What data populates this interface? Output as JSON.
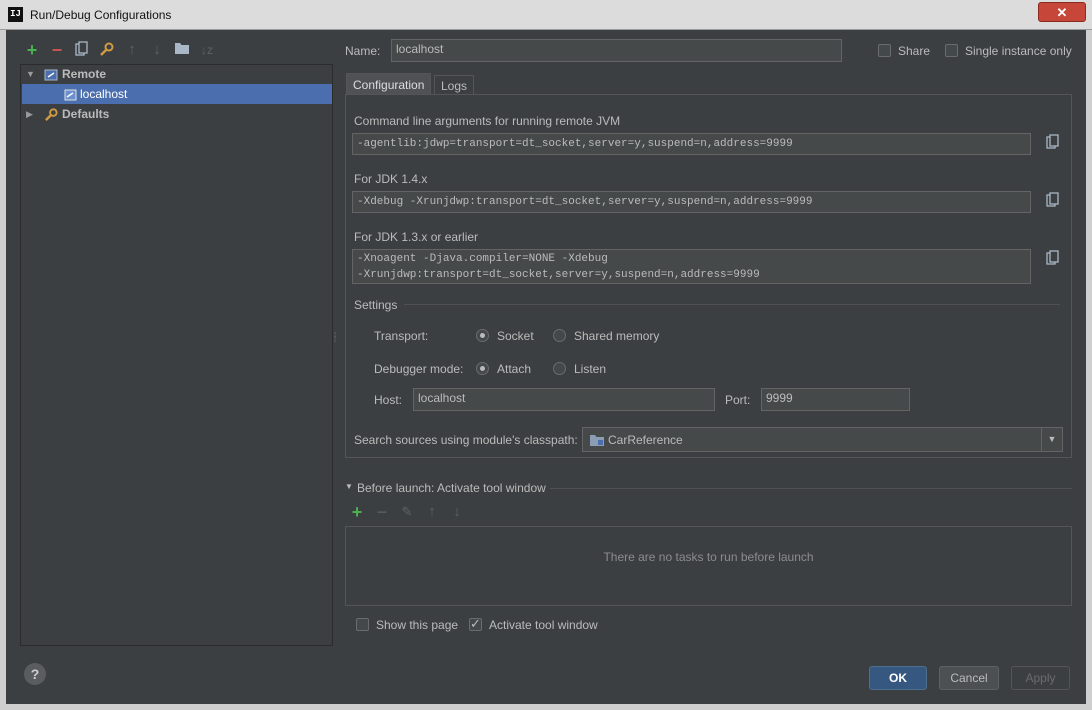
{
  "window": {
    "app_icon_text": "IJ",
    "title": "Run/Debug Configurations",
    "close_label": "✕"
  },
  "toolbar": {
    "icons": [
      "plus-icon",
      "minus-icon",
      "copy-icon",
      "wrench-icon",
      "arrow-up-icon",
      "arrow-down-icon",
      "folder-icon",
      "sort-icon"
    ]
  },
  "tree": {
    "items": [
      {
        "label": "Remote",
        "level": 0,
        "expanded": true,
        "icon": "remote-icon"
      },
      {
        "label": "localhost",
        "level": 1,
        "selected": true,
        "icon": "remote-config-icon"
      },
      {
        "label": "Defaults",
        "level": 0,
        "expanded": false,
        "icon": "wrench-icon"
      }
    ]
  },
  "form": {
    "name_label": "Name:",
    "name_value": "localhost",
    "share_label": "Share",
    "share_checked": false,
    "single_instance_label": "Single instance only",
    "single_instance_checked": false
  },
  "tabs": [
    {
      "label": "Configuration",
      "active": true
    },
    {
      "label": "Logs",
      "active": false
    }
  ],
  "config": {
    "cmd_label": "Command line arguments for running remote JVM",
    "cmd_value": "-agentlib:jdwp=transport=dt_socket,server=y,suspend=n,address=9999",
    "jdk14_label": "For JDK 1.4.x",
    "jdk14_value": "-Xdebug -Xrunjdwp:transport=dt_socket,server=y,suspend=n,address=9999",
    "jdk13_label": "For JDK 1.3.x or earlier",
    "jdk13_line1": "-Xnoagent -Djava.compiler=NONE -Xdebug",
    "jdk13_line2": "-Xrunjdwp:transport=dt_socket,server=y,suspend=n,address=9999",
    "settings_label": "Settings",
    "transport_label": "Transport:",
    "transport_options": [
      {
        "label": "Socket",
        "checked": true
      },
      {
        "label": "Shared memory",
        "checked": false
      }
    ],
    "debugger_mode_label": "Debugger mode:",
    "debugger_mode_options": [
      {
        "label": "Attach",
        "checked": true
      },
      {
        "label": "Listen",
        "checked": false
      }
    ],
    "host_label": "Host:",
    "host_value": "localhost",
    "port_label": "Port:",
    "port_value": "9999",
    "classpath_label": "Search sources using module's classpath:",
    "classpath_value": "CarReference"
  },
  "before_launch": {
    "title": "Before launch: Activate tool window",
    "empty_text": "There are no tasks to run before launch",
    "show_page_label": "Show this page",
    "show_page_checked": false,
    "activate_tool_label": "Activate tool window",
    "activate_tool_checked": true
  },
  "buttons": {
    "help": "?",
    "ok": "OK",
    "cancel": "Cancel",
    "apply": "Apply"
  },
  "colors": {
    "background": "#3c3f41",
    "selection": "#4b6eaf",
    "ok_button": "#365880",
    "add_green": "#4caf50",
    "remove_red": "#c75450"
  }
}
